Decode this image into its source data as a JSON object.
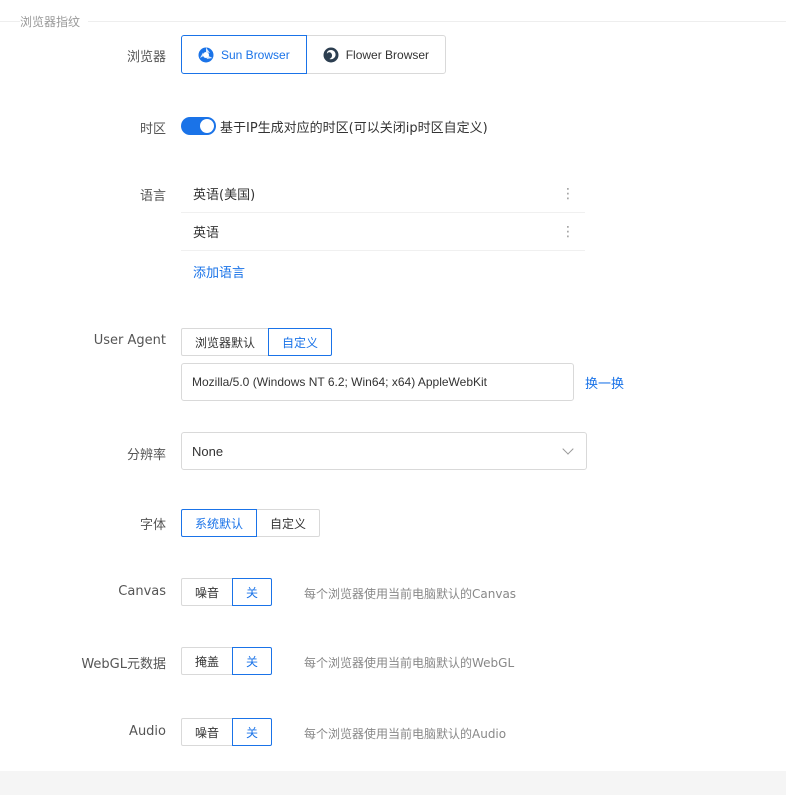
{
  "section": {
    "title": "浏览器指纹"
  },
  "browser": {
    "label": "浏览器",
    "options": [
      {
        "label": "Sun Browser",
        "icon": "sun-browser-icon",
        "active": true
      },
      {
        "label": "Flower Browser",
        "icon": "flower-browser-icon",
        "active": false
      }
    ]
  },
  "timezone": {
    "label": "时区",
    "toggle_on": true,
    "description": "基于IP生成对应的时区(可以关闭ip时区自定义)"
  },
  "language": {
    "label": "语言",
    "items": [
      "英语(美国)",
      "英语"
    ],
    "add_label": "添加语言"
  },
  "user_agent": {
    "label": "User Agent",
    "options": [
      "浏览器默认",
      "自定义"
    ],
    "selected": "自定义",
    "value": "Mozilla/5.0 (Windows NT 6.2; Win64; x64) AppleWebKit",
    "refresh_label": "换一换"
  },
  "resolution": {
    "label": "分辨率",
    "value": "None"
  },
  "font": {
    "label": "字体",
    "options": [
      "系统默认",
      "自定义"
    ],
    "selected": "系统默认"
  },
  "canvas": {
    "label": "Canvas",
    "options": [
      "噪音",
      "关"
    ],
    "selected": "关",
    "hint": "每个浏览器使用当前电脑默认的Canvas"
  },
  "webgl": {
    "label": "WebGL元数据",
    "options": [
      "掩盖",
      "关"
    ],
    "selected": "关",
    "hint": "每个浏览器使用当前电脑默认的WebGL"
  },
  "audio": {
    "label": "Audio",
    "options": [
      "噪音",
      "关"
    ],
    "selected": "关",
    "hint": "每个浏览器使用当前电脑默认的Audio"
  },
  "colors": {
    "accent": "#1a73e8",
    "border": "#d9d9d9"
  }
}
